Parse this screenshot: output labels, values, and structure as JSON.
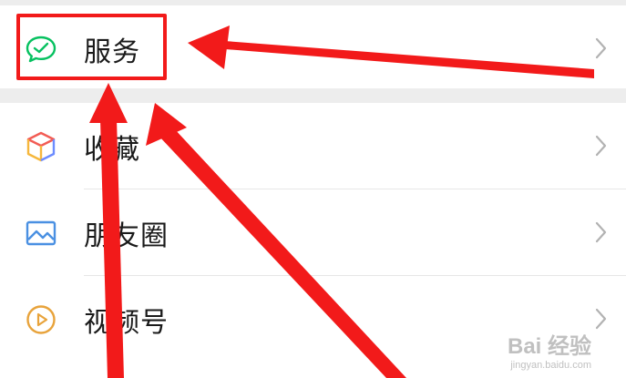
{
  "menu": {
    "items": [
      {
        "label": "服务",
        "icon": "wechat-pay-icon"
      },
      {
        "label": "收藏",
        "icon": "favorites-cube-icon"
      },
      {
        "label": "朋友圈",
        "icon": "moments-picture-icon"
      },
      {
        "label": "视频号",
        "icon": "channels-play-icon"
      }
    ]
  },
  "colors": {
    "annotation_red": "#f21a1a",
    "service_icon_green": "#07c160",
    "favorites_icon": [
      "#f25c54",
      "#f6b73c",
      "#6c8cff"
    ],
    "moments_icon_blue": "#4a90e2",
    "channels_icon_orange": "#e8a33b",
    "chevron_gray": "#b2b2b2"
  },
  "watermark": {
    "main": "Bai 经验",
    "sub": "jingyan.baidu.com"
  }
}
